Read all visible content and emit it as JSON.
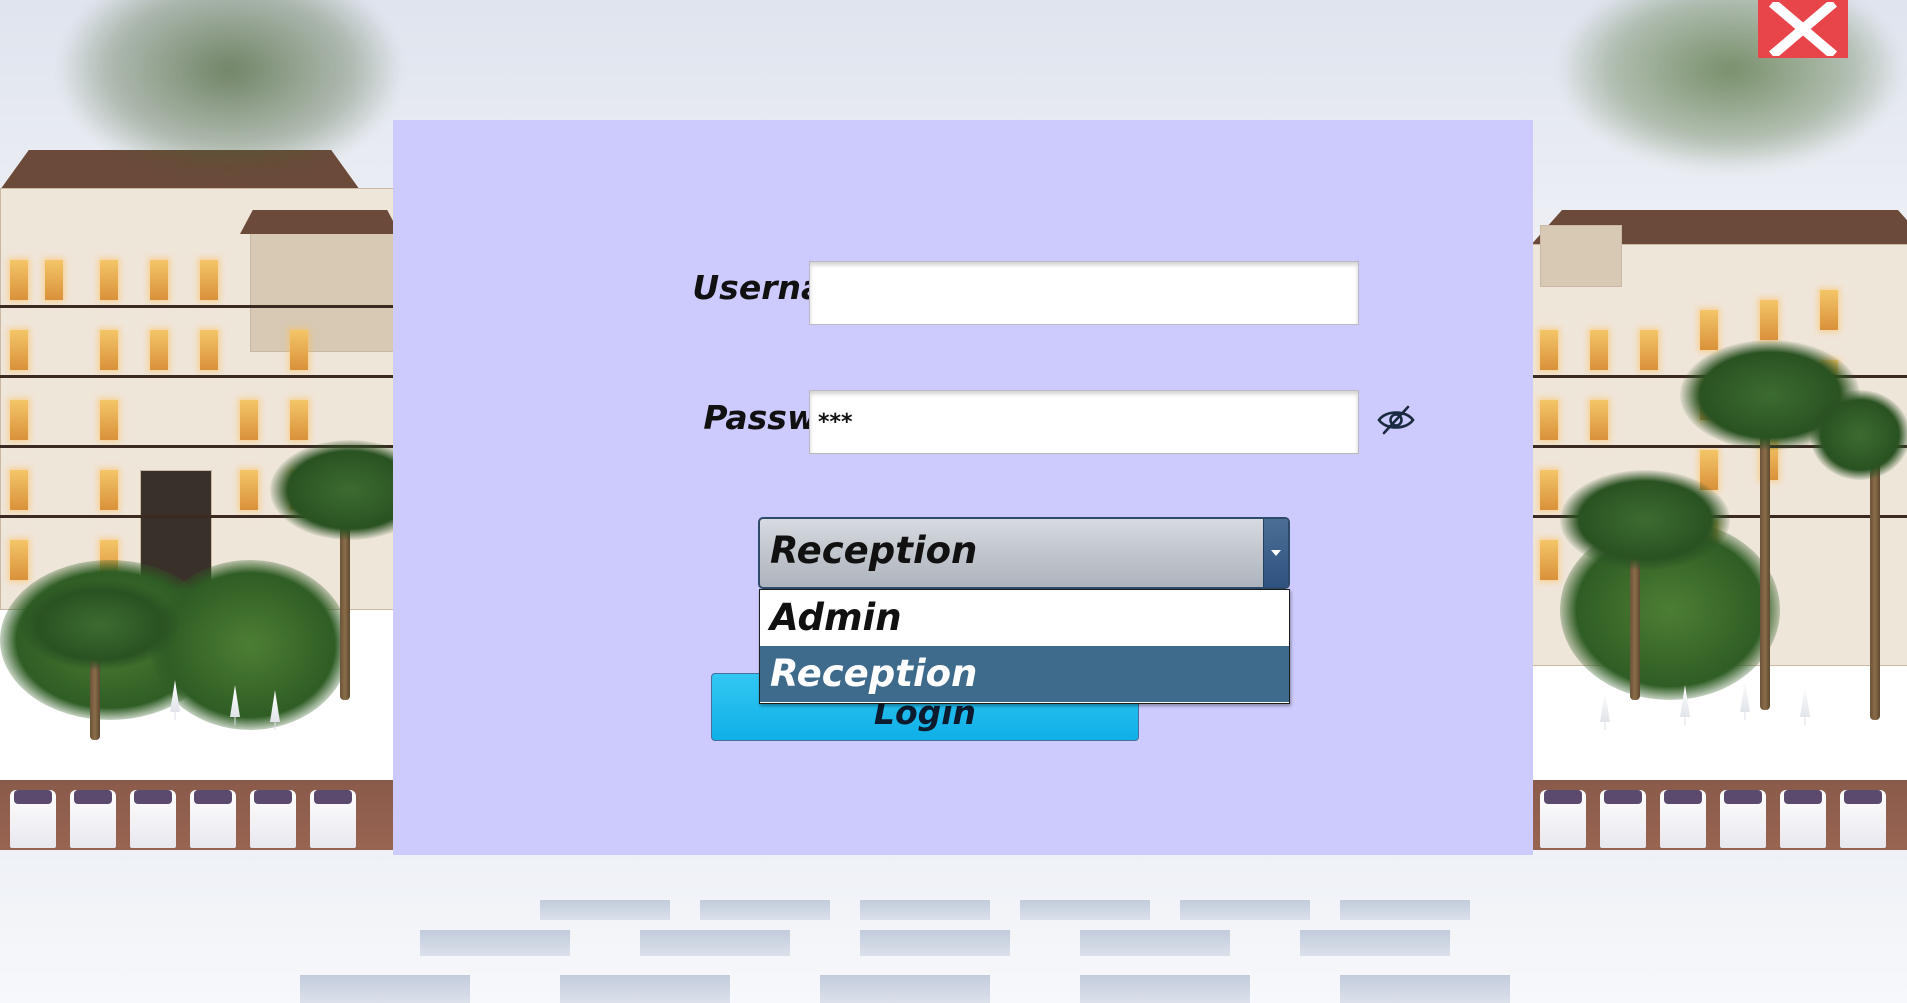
{
  "window": {
    "close_icon": "close-icon"
  },
  "login": {
    "username_label": "Username",
    "username_value": "",
    "password_label": "Password",
    "password_value": "***",
    "toggle_visibility_icon": "eye-slash-icon",
    "role_selected": "Reception",
    "role_options": [
      "Admin",
      "Reception"
    ],
    "login_button_label": "Login"
  },
  "colors": {
    "panel_background": "#cdcbfd",
    "close_button": "#e8454a",
    "login_button": "#0fb0e8",
    "dropdown_highlight": "#3e6a8c"
  }
}
